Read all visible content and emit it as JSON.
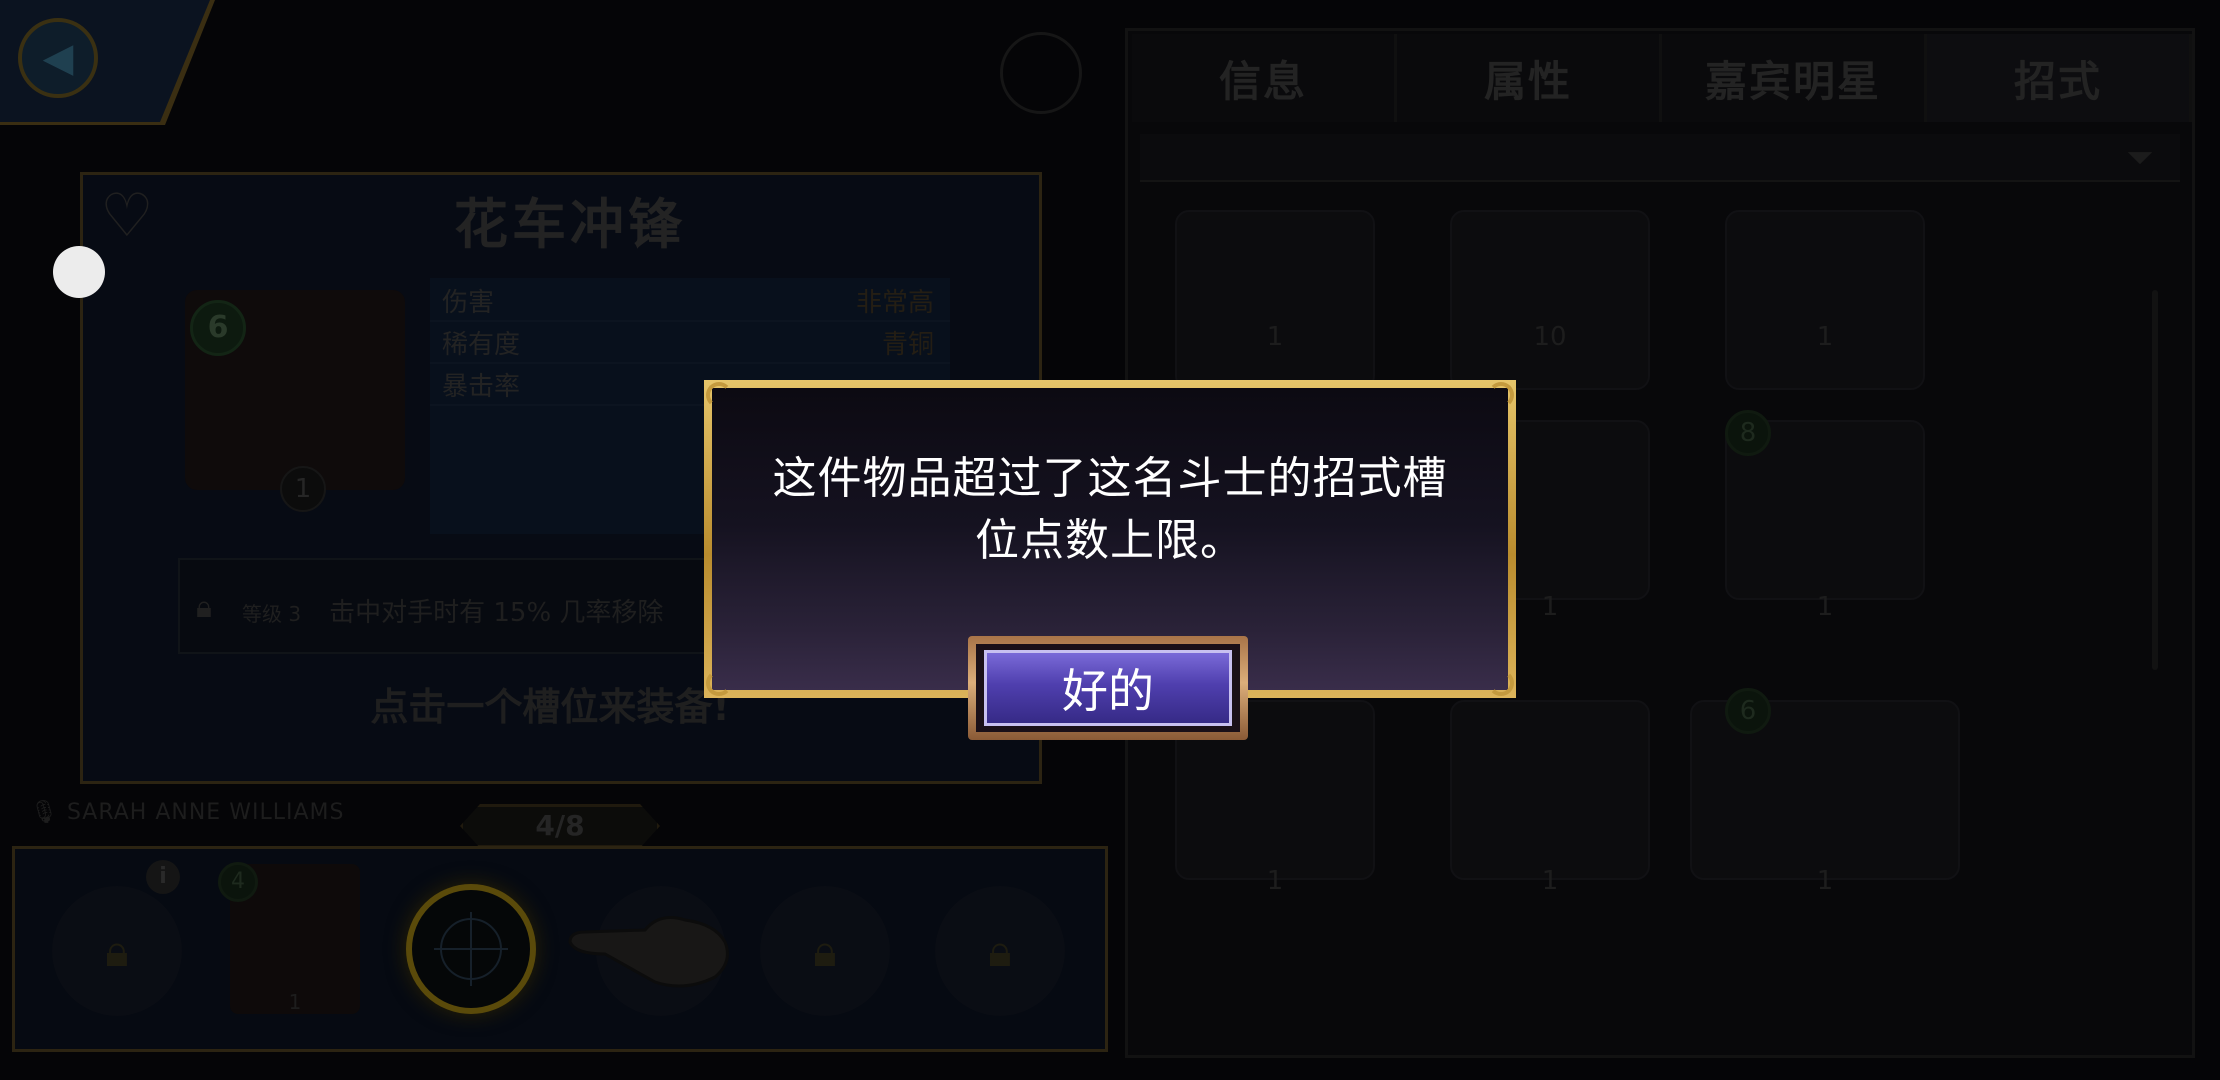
{
  "header": {
    "tabs": [
      "信息",
      "属性",
      "嘉宾明星",
      "招式"
    ],
    "active_tab": 3
  },
  "move_detail": {
    "name": "花车冲锋",
    "gear_level": "6",
    "card_level": "1",
    "stats": [
      {
        "key": "伤害",
        "value": "非常高"
      },
      {
        "key": "稀有度",
        "value": "青铜"
      },
      {
        "key": "暴击率",
        "value": ""
      }
    ],
    "lock_level": "等级 3",
    "lock_text": "击中对手时有 15% 几率移除",
    "equip_hint": "点击一个槽位来装备!"
  },
  "loadout": {
    "voice_actor": "SARAH ANNE WILLIAMS",
    "slot_counter": "4/8",
    "equipped_gear": "4",
    "equipped_level": "1"
  },
  "move_list": {
    "cards": [
      {
        "level": "1",
        "gear": ""
      },
      {
        "level": "10",
        "gear": ""
      },
      {
        "level": "1",
        "gear": ""
      },
      {
        "level": "",
        "gear": ""
      },
      {
        "level": "1",
        "gear": ""
      },
      {
        "level": "1",
        "gear": "8"
      },
      {
        "level": "1",
        "gear": ""
      },
      {
        "level": "1",
        "gear": ""
      },
      {
        "level": "1",
        "gear": "6"
      }
    ]
  },
  "dialog": {
    "message_line1": "这件物品超过了这名斗士的招式槽",
    "message_line2": "位点数上限。",
    "ok_label": "好的"
  },
  "colors": {
    "dialog_border": "#e6c56a",
    "ok_button": "#4f3fae"
  },
  "icons": {
    "back": "chevron-left-icon",
    "favorite": "heart-icon",
    "lock": "lock-icon",
    "filter": "funnel-icon",
    "pointer": "hand-pointer-icon",
    "info": "info-icon",
    "microphone": "microphone-icon"
  }
}
